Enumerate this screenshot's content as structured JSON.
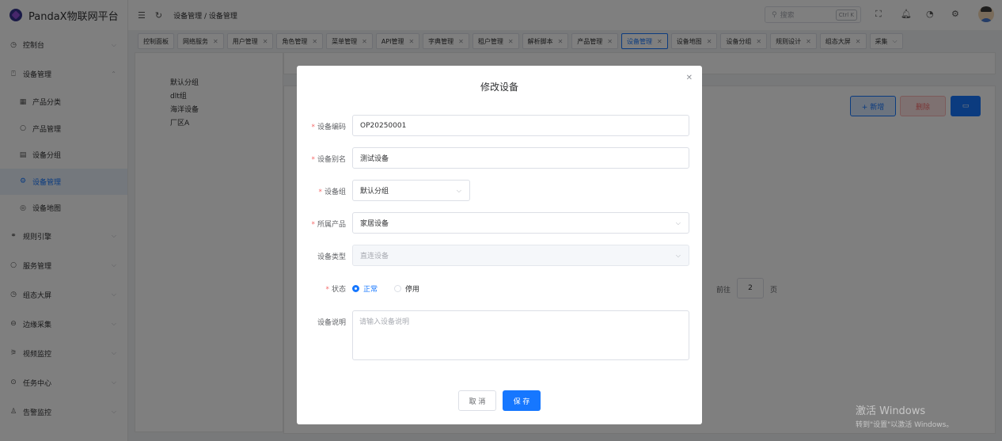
{
  "app": {
    "title": "PandaX物联网平台"
  },
  "header": {
    "breadcrumb": "设备管理 / 设备管理",
    "search_placeholder": "搜索",
    "search_shortcut": "Ctrl K"
  },
  "sidebar": {
    "items": [
      {
        "label": "控制台",
        "icon": "◷",
        "chevron": "⌵"
      },
      {
        "label": "设备管理",
        "icon": "⍞",
        "chevron": "⌃"
      },
      {
        "label": "产品分类",
        "icon": "▦",
        "sub": true
      },
      {
        "label": "产品管理",
        "icon": "○",
        "sub": true
      },
      {
        "label": "设备分组",
        "icon": "▤",
        "sub": true
      },
      {
        "label": "设备管理",
        "icon": "⚙",
        "sub": true,
        "active": true
      },
      {
        "label": "设备地图",
        "icon": "◎",
        "sub": true
      },
      {
        "label": "规则引擎",
        "icon": "⚭",
        "chevron": "⌵"
      },
      {
        "label": "服务管理",
        "icon": "○",
        "chevron": "⌵"
      },
      {
        "label": "组态大屏",
        "icon": "◷",
        "chevron": "⌵"
      },
      {
        "label": "边缘采集",
        "icon": "⊖",
        "chevron": "⌵"
      },
      {
        "label": "视频监控",
        "icon": "⚞",
        "chevron": "⌵"
      },
      {
        "label": "任务中心",
        "icon": "⊙",
        "chevron": "⌵"
      },
      {
        "label": "告警监控",
        "icon": "♙",
        "chevron": "⌵"
      }
    ]
  },
  "tabs": [
    {
      "label": "控制面板",
      "closable": false
    },
    {
      "label": "网络服务",
      "closable": true
    },
    {
      "label": "用户管理",
      "closable": true
    },
    {
      "label": "角色管理",
      "closable": true
    },
    {
      "label": "菜单管理",
      "closable": true
    },
    {
      "label": "API管理",
      "closable": true
    },
    {
      "label": "字典管理",
      "closable": true
    },
    {
      "label": "租户管理",
      "closable": true
    },
    {
      "label": "解析脚本",
      "closable": true
    },
    {
      "label": "产品管理",
      "closable": true
    },
    {
      "label": "设备管理",
      "closable": true,
      "active": true
    },
    {
      "label": "设备地图",
      "closable": true
    },
    {
      "label": "设备分组",
      "closable": true
    },
    {
      "label": "规则设计",
      "closable": true
    },
    {
      "label": "组态大屏",
      "closable": true
    },
    {
      "label": "采集",
      "closable": false,
      "more": true
    }
  ],
  "tree": [
    "默认分组",
    "dlt组",
    "海洋设备",
    "厂区A"
  ],
  "toolbar": {
    "add_label": "+ 新增",
    "delete_label": "删除"
  },
  "pager": {
    "goto_label": "前往",
    "page": "2",
    "page_suffix": "页"
  },
  "dialog": {
    "title": "修改设备",
    "fields": {
      "code": {
        "label": "设备编码",
        "value": "OP20250001",
        "required": true
      },
      "alias": {
        "label": "设备别名",
        "value": "测试设备",
        "required": true
      },
      "group": {
        "label": "设备组",
        "value": "默认分组",
        "required": true
      },
      "product": {
        "label": "所属产品",
        "value": "家居设备",
        "required": true
      },
      "type": {
        "label": "设备类型",
        "value": "直连设备",
        "required": false
      },
      "status": {
        "label": "状态",
        "options": [
          "正常",
          "停用"
        ],
        "selected": "正常",
        "required": true
      },
      "desc": {
        "label": "设备说明",
        "placeholder": "请输入设备说明"
      }
    },
    "cancel_label": "取 消",
    "save_label": "保 存"
  },
  "watermark": {
    "line1": "激活 Windows",
    "line2": "转到\"设置\"以激活 Windows。"
  },
  "colors": {
    "primary": "#1677ff",
    "required": "#f56c6c"
  }
}
